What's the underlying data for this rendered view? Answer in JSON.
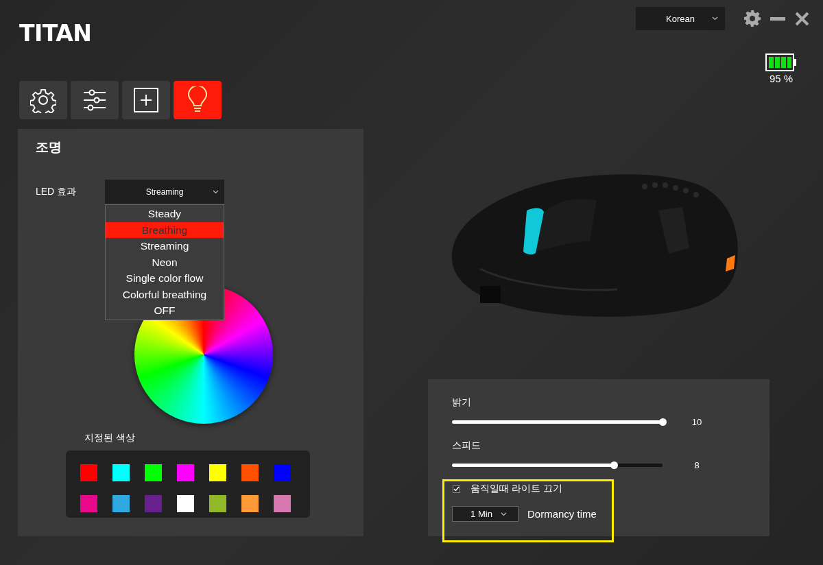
{
  "header": {
    "logo": "TITAN",
    "language_select": {
      "value": "Korean"
    },
    "battery": {
      "reading": "95 %"
    }
  },
  "tabs": [
    {
      "kind": "settings",
      "selected": false
    },
    {
      "kind": "adjust",
      "selected": false
    },
    {
      "kind": "macro",
      "selected": false
    },
    {
      "kind": "lighting",
      "selected": true
    }
  ],
  "lighting_panel": {
    "title": "조명",
    "led_effect": {
      "label": "LED 효과",
      "value": "Streaming",
      "expanded": true,
      "options": [
        {
          "label": "Steady",
          "highlighted": false
        },
        {
          "label": "Breathing",
          "highlighted": true
        },
        {
          "label": "Streaming",
          "highlighted": false
        },
        {
          "label": "Neon",
          "highlighted": false
        },
        {
          "label": "Single color flow",
          "highlighted": false
        },
        {
          "label": "Colorful breathing",
          "highlighted": false
        },
        {
          "label": "OFF",
          "highlighted": false
        }
      ]
    },
    "preset_colors": {
      "label": "지정된 색상",
      "swatches": [
        {
          "color": "#ff0000"
        },
        {
          "color": "#00ffff"
        },
        {
          "color": "#00ff00"
        },
        {
          "color": "#ff00ff"
        },
        {
          "color": "#ffff00"
        },
        {
          "color": "#ff5000"
        },
        {
          "color": "#0000ff"
        },
        {
          "color": "#e8088a"
        },
        {
          "color": "#30a8e0"
        },
        {
          "color": "#68208e"
        },
        {
          "color": "#ffffff"
        },
        {
          "color": "#90b828"
        },
        {
          "color": "#ff9a38"
        },
        {
          "color": "#d878b0"
        }
      ]
    }
  },
  "adjust_panel": {
    "sliders": [
      {
        "label": "밝기",
        "level": 1,
        "reading": "10"
      },
      {
        "label": "스피드",
        "level": 0.77,
        "reading": "8"
      }
    ],
    "light_off_on_move": {
      "label": "움직일때 라이트 끄기",
      "checked": true
    },
    "dormancy": {
      "value": "1 Min",
      "label": "Dormancy time"
    }
  }
}
